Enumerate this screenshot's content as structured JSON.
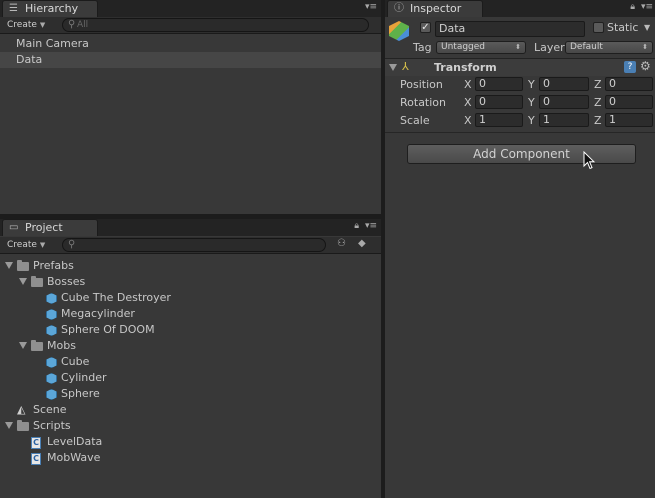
{
  "hierarchy": {
    "tab_label": "Hierarchy",
    "create_label": "Create",
    "search_placeholder": "All",
    "items": [
      "Main Camera",
      "Data"
    ]
  },
  "project": {
    "tab_label": "Project",
    "create_label": "Create",
    "tree": [
      {
        "label": "Prefabs",
        "kind": "folder"
      },
      {
        "label": "Bosses",
        "kind": "folder"
      },
      {
        "label": "Cube The Destroyer",
        "kind": "prefab"
      },
      {
        "label": "Megacylinder",
        "kind": "prefab"
      },
      {
        "label": "Sphere Of DOOM",
        "kind": "prefab"
      },
      {
        "label": "Mobs",
        "kind": "folder"
      },
      {
        "label": "Cube",
        "kind": "prefab"
      },
      {
        "label": "Cylinder",
        "kind": "prefab"
      },
      {
        "label": "Sphere",
        "kind": "prefab"
      },
      {
        "label": "Scene",
        "kind": "scene"
      },
      {
        "label": "Scripts",
        "kind": "folder"
      },
      {
        "label": "LevelData",
        "kind": "script"
      },
      {
        "label": "MobWave",
        "kind": "script"
      }
    ]
  },
  "inspector": {
    "tab_label": "Inspector",
    "object_name": "Data",
    "static_label": "Static",
    "tag_label": "Tag",
    "tag_value": "Untagged",
    "layer_label": "Layer",
    "layer_value": "Default",
    "transform_label": "Transform",
    "rows": [
      {
        "label": "Position",
        "x": "0",
        "y": "0",
        "z": "0"
      },
      {
        "label": "Rotation",
        "x": "0",
        "y": "0",
        "z": "0"
      },
      {
        "label": "Scale",
        "x": "1",
        "y": "1",
        "z": "1"
      }
    ],
    "axis_labels": {
      "x": "X",
      "y": "Y",
      "z": "Z"
    },
    "add_component_label": "Add Component"
  },
  "colors": {
    "panel_bg": "#383838",
    "selection": "#464646",
    "prefab_blue": "#5ba6d8"
  }
}
